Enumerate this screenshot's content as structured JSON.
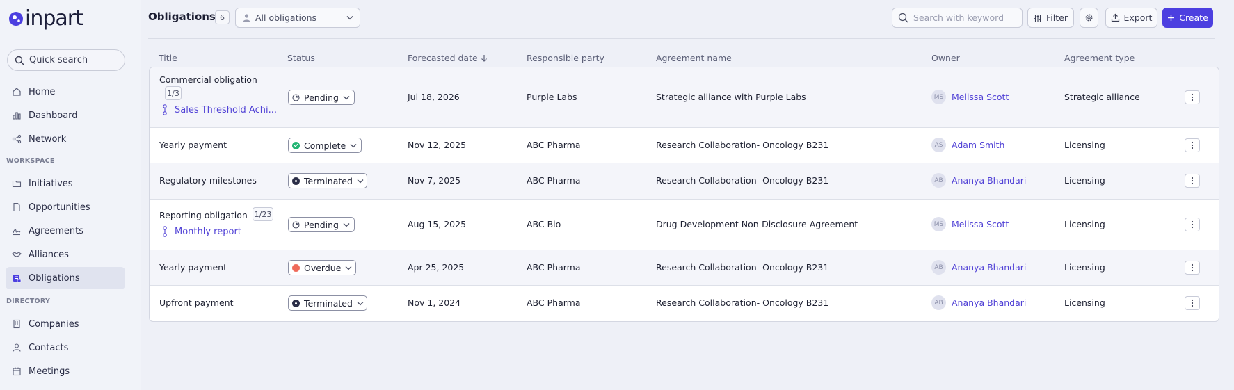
{
  "app": {
    "logo_text": "inpart"
  },
  "sidebar": {
    "quick_search_label": "Quick search",
    "items_top": [
      {
        "label": "Home",
        "icon": "home-icon"
      },
      {
        "label": "Dashboard",
        "icon": "bar-chart-icon"
      },
      {
        "label": "Network",
        "icon": "share-icon"
      }
    ],
    "section_workspace": "WORKSPACE",
    "items_workspace": [
      {
        "label": "Initiatives",
        "icon": "folder-icon"
      },
      {
        "label": "Opportunities",
        "icon": "file-icon"
      },
      {
        "label": "Agreements",
        "icon": "signature-icon"
      },
      {
        "label": "Alliances",
        "icon": "handshake-icon"
      },
      {
        "label": "Obligations",
        "icon": "obligations-icon",
        "active": true
      }
    ],
    "section_directory": "DIRECTORY",
    "items_directory": [
      {
        "label": "Companies",
        "icon": "building-icon"
      },
      {
        "label": "Contacts",
        "icon": "user-icon"
      },
      {
        "label": "Meetings",
        "icon": "calendar-icon"
      }
    ]
  },
  "header": {
    "title": "Obligations",
    "count": "6",
    "filter_select": "All obligations",
    "search_placeholder": "Search with keyword",
    "filter_label": "Filter",
    "export_label": "Export",
    "create_label": "Create"
  },
  "table": {
    "columns": {
      "title": "Title",
      "status": "Status",
      "forecasted_date": "Forecasted date",
      "responsible_party": "Responsible party",
      "agreement_name": "Agreement name",
      "owner": "Owner",
      "agreement_type": "Agreement type"
    },
    "rows": [
      {
        "title": "Commercial obligation",
        "sub_count": "1/3",
        "sub_link": "Sales Threshold Achi...",
        "status": "Pending",
        "date": "Jul 18, 2026",
        "party": "Purple Labs",
        "agreement": "Strategic alliance with Purple Labs",
        "owner_initials": "MS",
        "owner": "Melissa Scott",
        "type": "Strategic alliance"
      },
      {
        "title": "Yearly payment",
        "status": "Complete",
        "date": "Nov 12, 2025",
        "party": "ABC Pharma",
        "agreement": "Research Collaboration- Oncology B231",
        "owner_initials": "AS",
        "owner": "Adam Smith",
        "type": "Licensing"
      },
      {
        "title": "Regulatory milestones",
        "status": "Terminated",
        "date": "Nov 7, 2025",
        "party": "ABC Pharma",
        "agreement": "Research Collaboration- Oncology B231",
        "owner_initials": "AB",
        "owner": "Ananya Bhandari",
        "type": "Licensing"
      },
      {
        "title": "Reporting obligation",
        "sub_count": "1/23",
        "sub_link": "Monthly report",
        "status": "Pending",
        "date": "Aug 15, 2025",
        "party": "ABC Bio",
        "agreement": "Drug Development Non-Disclosure Agreement",
        "owner_initials": "MS",
        "owner": "Melissa Scott",
        "type": "Licensing"
      },
      {
        "title": "Yearly payment",
        "status": "Overdue",
        "date": "Apr 25, 2025",
        "party": "ABC Pharma",
        "agreement": "Research Collaboration- Oncology B231",
        "owner_initials": "AB",
        "owner": "Ananya Bhandari",
        "type": "Licensing"
      },
      {
        "title": "Upfront payment",
        "status": "Terminated",
        "date": "Nov 1, 2024",
        "party": "ABC Pharma",
        "agreement": "Research Collaboration- Oncology B231",
        "owner_initials": "AB",
        "owner": "Ananya Bhandari",
        "type": "Licensing"
      }
    ]
  },
  "colors": {
    "accent": "#4c3fe0",
    "link": "#5142d6",
    "status_complete": "#22b573",
    "status_overdue": "#ef6a5a",
    "status_terminated": "#2b2e47",
    "status_pending": "#4a4e63"
  }
}
